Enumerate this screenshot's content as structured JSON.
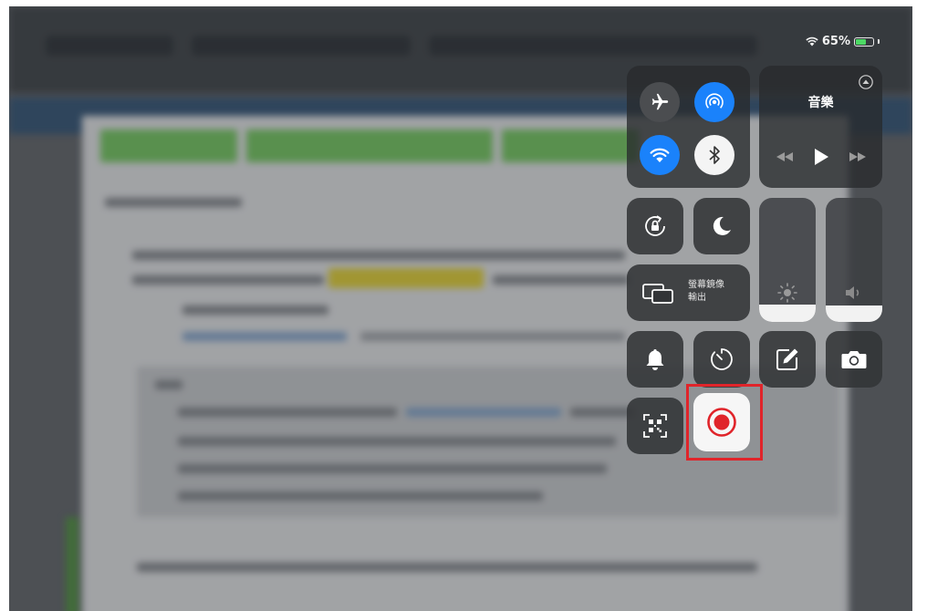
{
  "status_bar": {
    "battery_percent": "65%",
    "battery_level": 0.65,
    "battery_color": "#4cd964"
  },
  "connectivity": {
    "airplane": {
      "icon": "airplane-icon",
      "active": false
    },
    "airdrop": {
      "icon": "airdrop-icon",
      "active": true
    },
    "wifi": {
      "icon": "wifi-icon",
      "active": true
    },
    "bluetooth": {
      "icon": "bluetooth-icon",
      "active": true
    }
  },
  "music": {
    "title": "音樂",
    "controls": [
      "rewind-icon",
      "play-icon",
      "fast-forward-icon"
    ]
  },
  "screen_mirroring": {
    "label_line1": "螢幕鏡像",
    "label_line2": "輸出"
  },
  "sliders": {
    "brightness_level": 0.14,
    "volume_level": 0.13
  },
  "shortcuts": [
    "rotation-lock-icon",
    "do-not-disturb-icon",
    "bell-icon",
    "timer-icon",
    "notes-icon",
    "camera-icon",
    "qr-scanner-icon",
    "screen-record-icon"
  ],
  "colors": {
    "accent_blue": "#1a82fb",
    "record_red": "#e0242a",
    "highlight_red": "#e0242a"
  }
}
